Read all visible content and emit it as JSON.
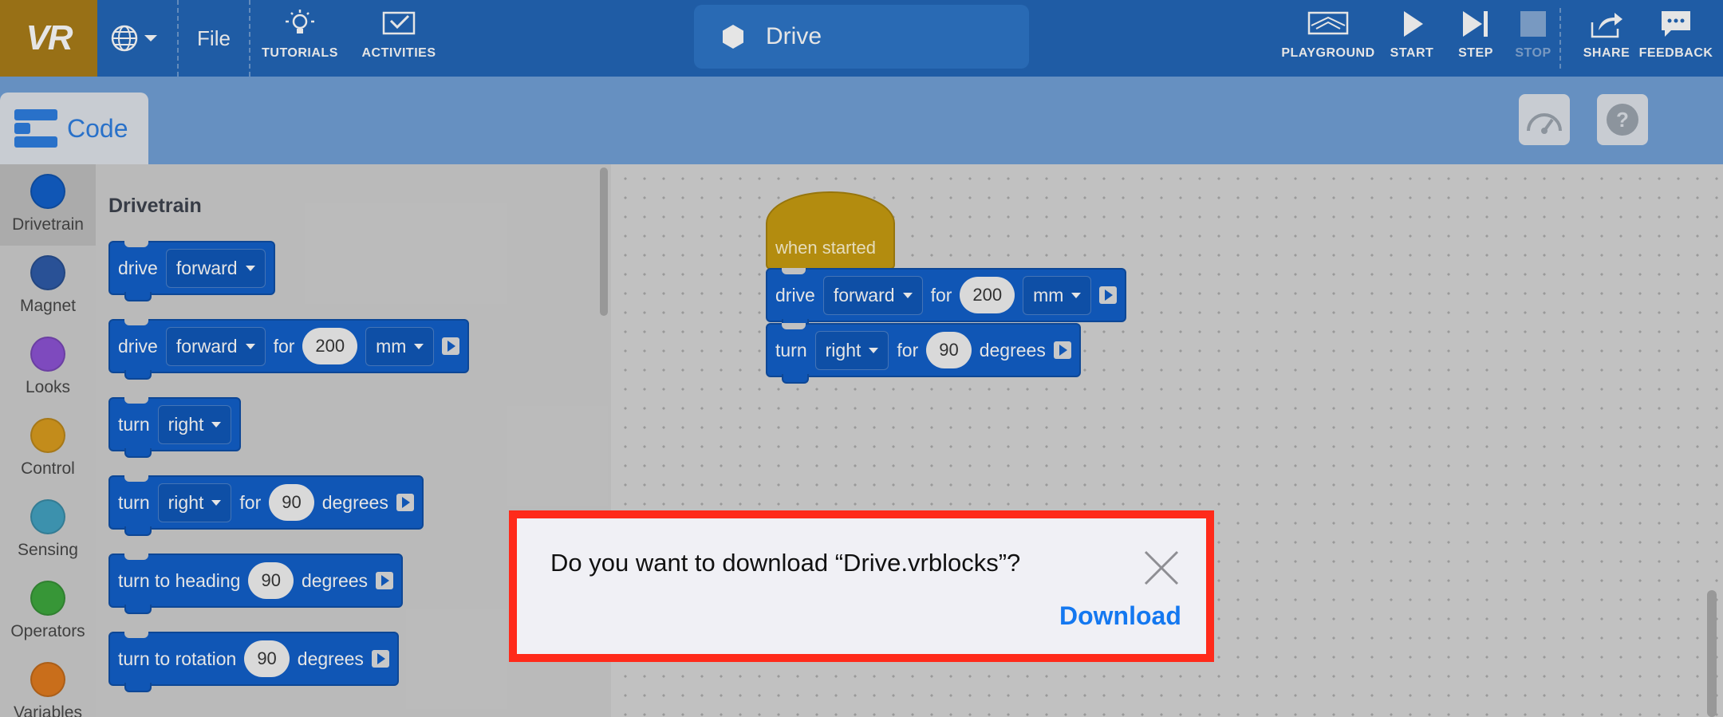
{
  "topbar": {
    "logo": "VR",
    "file_label": "File",
    "tools_left": [
      {
        "label": "TUTORIALS",
        "icon": "lightbulb-icon"
      },
      {
        "label": "ACTIVITIES",
        "icon": "activities-check-icon"
      }
    ],
    "project_name": "Drive",
    "tools_right": [
      {
        "label": "PLAYGROUND",
        "icon": "playground-icon",
        "enabled": true
      },
      {
        "label": "START",
        "icon": "play-icon",
        "enabled": true
      },
      {
        "label": "STEP",
        "icon": "step-icon",
        "enabled": true
      },
      {
        "label": "STOP",
        "icon": "stop-icon",
        "enabled": false
      },
      {
        "label": "SHARE",
        "icon": "share-icon",
        "enabled": true
      },
      {
        "label": "FEEDBACK",
        "icon": "feedback-icon",
        "enabled": true
      }
    ]
  },
  "subbar": {
    "code_tab_label": "Code"
  },
  "categories": [
    {
      "label": "Drivetrain",
      "color": "#0d5dc9",
      "active": true
    },
    {
      "label": "Magnet",
      "color": "#2a57a6",
      "active": false
    },
    {
      "label": "Looks",
      "color": "#8a4fd3",
      "active": false
    },
    {
      "label": "Control",
      "color": "#d99a1a",
      "active": false
    },
    {
      "label": "Sensing",
      "color": "#3fa0c0",
      "active": false
    },
    {
      "label": "Operators",
      "color": "#3aa53a",
      "active": false
    },
    {
      "label": "Variables",
      "color": "#e0781a",
      "active": false
    }
  ],
  "flyout": {
    "title": "Drivetrain",
    "blocks": {
      "b1": {
        "drive": "drive",
        "dir": "forward"
      },
      "b2": {
        "drive": "drive",
        "dir": "forward",
        "for": "for",
        "value": "200",
        "unit": "mm"
      },
      "b3": {
        "turn": "turn",
        "dir": "right"
      },
      "b4": {
        "turn": "turn",
        "dir": "right",
        "for": "for",
        "value": "90",
        "unit": "degrees"
      },
      "b5": {
        "text": "turn to heading",
        "value": "90",
        "unit": "degrees"
      },
      "b6": {
        "text": "turn to rotation",
        "value": "90",
        "unit": "degrees"
      }
    }
  },
  "workspace": {
    "hat_label": "when started",
    "drive": {
      "drive": "drive",
      "dir": "forward",
      "for": "for",
      "value": "200",
      "unit": "mm"
    },
    "turn": {
      "turn": "turn",
      "dir": "right",
      "for": "for",
      "value": "90",
      "unit": "degrees"
    }
  },
  "dialog": {
    "message": "Do you want to download “Drive.vrblocks”?",
    "download_label": "Download"
  }
}
